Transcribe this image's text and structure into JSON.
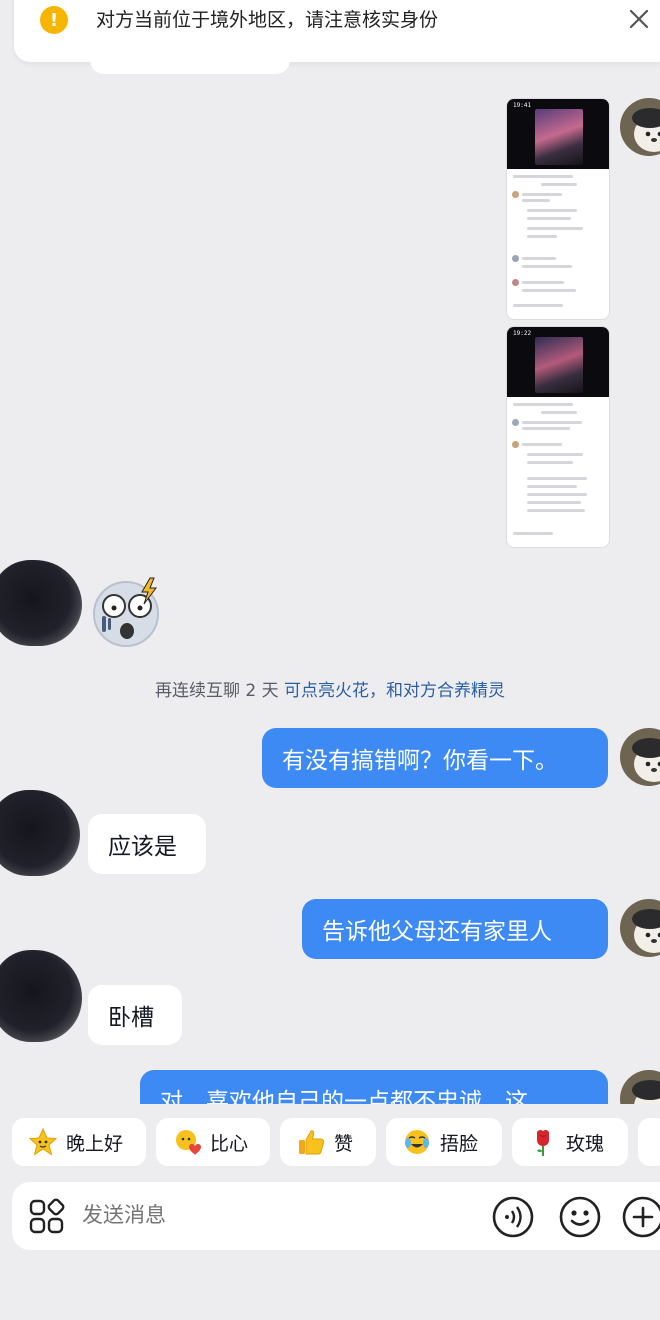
{
  "banner": {
    "text": "对方当前位于境外地区，请注意核实身份",
    "warn_glyph": "!"
  },
  "system_message": {
    "text_prefix": "再连续互聊 2 天",
    "text_link": "可点亮火花，和对方合养精灵"
  },
  "messages": [
    {
      "side": "me",
      "text": "有没有搞错啊？你看一下。"
    },
    {
      "side": "them",
      "text": "应该是"
    },
    {
      "side": "me",
      "text": "告诉他父母还有家里人"
    },
    {
      "side": "them",
      "text": "卧槽"
    },
    {
      "side": "me",
      "text": "对，喜欢他自己的一点都不忠诚，这"
    }
  ],
  "screenshots": [
    {
      "time": "19:41"
    },
    {
      "time": "19:22"
    }
  ],
  "quick_replies": [
    {
      "label": "晚上好",
      "icon": "star-face-icon"
    },
    {
      "label": "比心",
      "icon": "heart-hands-icon"
    },
    {
      "label": "赞",
      "icon": "thumbs-up-icon"
    },
    {
      "label": "捂脸",
      "icon": "facepalm-icon"
    },
    {
      "label": "玫瑰",
      "icon": "rose-icon"
    }
  ],
  "input": {
    "placeholder": "发送消息"
  },
  "colors": {
    "my_bubble": "#3d8af5",
    "their_bubble": "#ffffff",
    "background": "#ededf0",
    "link": "#2a5fa8",
    "warning": "#f7b500"
  }
}
